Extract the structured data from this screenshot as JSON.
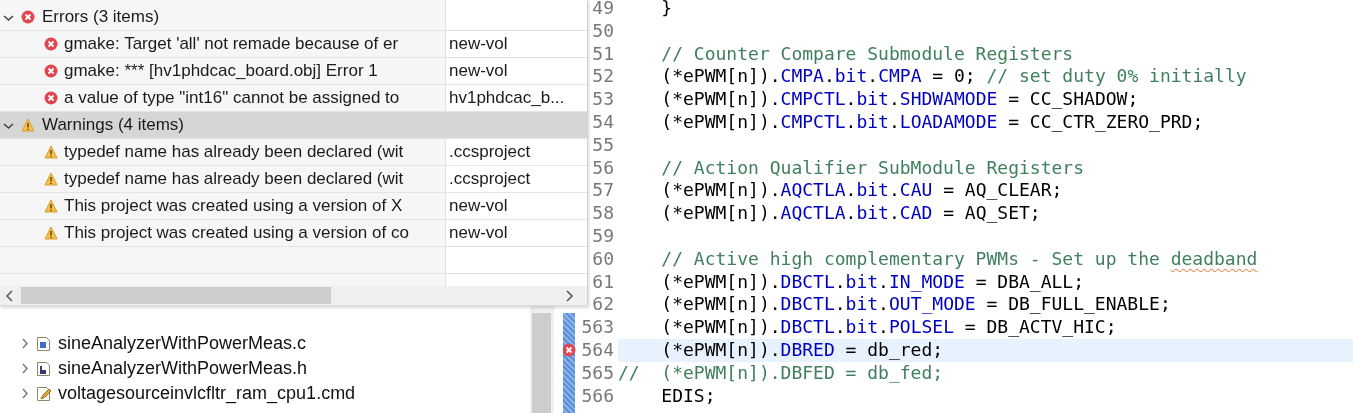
{
  "problems": {
    "groups": [
      {
        "kind": "error",
        "label": "Errors (3 items)",
        "expanded": true,
        "selected": false,
        "items": [
          {
            "description": "gmake: Target 'all' not remade because of er",
            "resource": "new-vol"
          },
          {
            "description": "gmake: *** [hv1phdcac_board.obj] Error 1",
            "resource": "new-vol"
          },
          {
            "description": "a value of type \"int16\" cannot be assigned to",
            "resource": "hv1phdcac_b..."
          }
        ]
      },
      {
        "kind": "warning",
        "label": "Warnings (4 items)",
        "expanded": true,
        "selected": true,
        "items": [
          {
            "description": "typedef name has already been declared (wit",
            "resource": ".ccsproject"
          },
          {
            "description": "typedef name has already been declared (wit",
            "resource": ".ccsproject"
          },
          {
            "description": "This project was created using a version of X",
            "resource": "new-vol"
          },
          {
            "description": "This project was created using a version of co",
            "resource": "new-vol"
          }
        ]
      }
    ]
  },
  "tree": {
    "items": [
      {
        "name": "sineAnalyzerWithPowerMeas.c",
        "kind": "c-file",
        "expanded": false
      },
      {
        "name": "sineAnalyzerWithPowerMeas.h",
        "kind": "h-file",
        "expanded": false
      },
      {
        "name": "voltagesourceinvlcfltr_ram_cpu1.cmd",
        "kind": "cmd-file",
        "expanded": false
      }
    ]
  },
  "editor": {
    "lines": [
      {
        "number": "49",
        "current": false,
        "tokens": [
          {
            "kind": "plain",
            "text": "    }"
          }
        ]
      },
      {
        "number": "50",
        "current": false
      },
      {
        "number": "51",
        "current": false,
        "tokens": [
          {
            "kind": "comment",
            "text": "    // Counter Compare Submodule Registers"
          }
        ]
      },
      {
        "number": "52",
        "current": false,
        "tokens": [
          {
            "kind": "plain",
            "text": "    (*ePWM[n])."
          },
          {
            "kind": "field",
            "text": "CMPA"
          },
          {
            "kind": "plain",
            "text": "."
          },
          {
            "kind": "field",
            "text": "bit"
          },
          {
            "kind": "plain",
            "text": "."
          },
          {
            "kind": "field",
            "text": "CMPA"
          },
          {
            "kind": "plain",
            "text": " = 0; "
          },
          {
            "kind": "comment",
            "text": "// set duty 0% initially"
          }
        ]
      },
      {
        "number": "53",
        "current": false,
        "tokens": [
          {
            "kind": "plain",
            "text": "    (*ePWM[n])."
          },
          {
            "kind": "field",
            "text": "CMPCTL"
          },
          {
            "kind": "plain",
            "text": "."
          },
          {
            "kind": "field",
            "text": "bit"
          },
          {
            "kind": "plain",
            "text": "."
          },
          {
            "kind": "field",
            "text": "SHDWAMODE"
          },
          {
            "kind": "plain",
            "text": " = CC_SHADOW;"
          }
        ]
      },
      {
        "number": "54",
        "current": false,
        "tokens": [
          {
            "kind": "plain",
            "text": "    (*ePWM[n])."
          },
          {
            "kind": "field",
            "text": "CMPCTL"
          },
          {
            "kind": "plain",
            "text": "."
          },
          {
            "kind": "field",
            "text": "bit"
          },
          {
            "kind": "plain",
            "text": "."
          },
          {
            "kind": "field",
            "text": "LOADAMODE"
          },
          {
            "kind": "plain",
            "text": " = CC_CTR_ZERO_PRD;"
          }
        ]
      },
      {
        "number": "55",
        "current": false
      },
      {
        "number": "56",
        "current": false,
        "tokens": [
          {
            "kind": "comment",
            "text": "    // Action Qualifier SubModule Registers"
          }
        ]
      },
      {
        "number": "57",
        "current": false,
        "tokens": [
          {
            "kind": "plain",
            "text": "    (*ePWM[n])."
          },
          {
            "kind": "field",
            "text": "AQCTLA"
          },
          {
            "kind": "plain",
            "text": "."
          },
          {
            "kind": "field",
            "text": "bit"
          },
          {
            "kind": "plain",
            "text": "."
          },
          {
            "kind": "field",
            "text": "CAU"
          },
          {
            "kind": "plain",
            "text": " = AQ_CLEAR;"
          }
        ]
      },
      {
        "number": "58",
        "current": false,
        "tokens": [
          {
            "kind": "plain",
            "text": "    (*ePWM[n])."
          },
          {
            "kind": "field",
            "text": "AQCTLA"
          },
          {
            "kind": "plain",
            "text": "."
          },
          {
            "kind": "field",
            "text": "bit"
          },
          {
            "kind": "plain",
            "text": "."
          },
          {
            "kind": "field",
            "text": "CAD"
          },
          {
            "kind": "plain",
            "text": " = AQ_SET;"
          }
        ]
      },
      {
        "number": "59",
        "current": false
      },
      {
        "number": "60",
        "current": false,
        "tokens": [
          {
            "kind": "comment",
            "text": "    // Active high complementary PWMs - Set up the "
          },
          {
            "kind": "comment",
            "text": "deadband",
            "misspelled": true
          }
        ]
      },
      {
        "number": "61",
        "current": false,
        "tokens": [
          {
            "kind": "plain",
            "text": "    (*ePWM[n])."
          },
          {
            "kind": "field",
            "text": "DBCTL"
          },
          {
            "kind": "plain",
            "text": "."
          },
          {
            "kind": "field",
            "text": "bit"
          },
          {
            "kind": "plain",
            "text": "."
          },
          {
            "kind": "field",
            "text": "IN_MODE"
          },
          {
            "kind": "plain",
            "text": " = DBA_ALL;"
          }
        ]
      },
      {
        "number": "62",
        "current": false,
        "tokens": [
          {
            "kind": "plain",
            "text": "    (*ePWM[n])."
          },
          {
            "kind": "field",
            "text": "DBCTL"
          },
          {
            "kind": "plain",
            "text": "."
          },
          {
            "kind": "field",
            "text": "bit"
          },
          {
            "kind": "plain",
            "text": "."
          },
          {
            "kind": "field",
            "text": "OUT_MODE"
          },
          {
            "kind": "plain",
            "text": " = DB_FULL_ENABLE;"
          }
        ]
      },
      {
        "number": "563",
        "current": false,
        "tokens": [
          {
            "kind": "plain",
            "text": "    (*ePWM[n])."
          },
          {
            "kind": "field",
            "text": "DBCTL"
          },
          {
            "kind": "plain",
            "text": "."
          },
          {
            "kind": "field",
            "text": "bit"
          },
          {
            "kind": "plain",
            "text": "."
          },
          {
            "kind": "field",
            "text": "POLSEL"
          },
          {
            "kind": "plain",
            "text": " = DB_ACTV_HIC;"
          }
        ]
      },
      {
        "number": "564",
        "current": true,
        "error": true,
        "tokens": [
          {
            "kind": "plain",
            "text": "    (*ePWM[n])."
          },
          {
            "kind": "field",
            "text": "DBRED"
          },
          {
            "kind": "plain",
            "text": " = db_red;"
          }
        ]
      },
      {
        "number": "565",
        "current": false,
        "tokens": [
          {
            "kind": "comment",
            "text": "//  (*ePWM[n]).DBFED = db_fed;"
          }
        ]
      },
      {
        "number": "566",
        "current": false,
        "tokens": [
          {
            "kind": "plain",
            "text": "    EDIS;"
          }
        ]
      }
    ]
  }
}
